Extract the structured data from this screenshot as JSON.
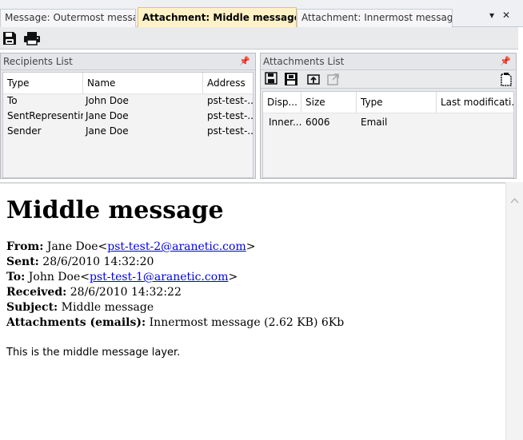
{
  "tabs": [
    {
      "label": "Message: Outermost message"
    },
    {
      "label": "Attachment:  Middle  message..."
    },
    {
      "label": "Attachment:  Innermost  message..."
    }
  ],
  "toolbar": {
    "icons": [
      "save-icon",
      "print-icon"
    ]
  },
  "recipients": {
    "title": "Recipients List",
    "columns": [
      "Type",
      "Name",
      "Address"
    ],
    "rows": [
      [
        "To",
        "John Doe",
        "pst-test-..."
      ],
      [
        "SentRepresenting",
        "Jane Doe",
        "pst-test-..."
      ],
      [
        "Sender",
        "Jane Doe",
        "pst-test-..."
      ]
    ]
  },
  "attachments": {
    "title": "Attachments List",
    "columns": [
      "Disp...",
      "Size",
      "Type",
      "Last modificati..."
    ],
    "rows": [
      [
        "Inner...",
        "6006",
        "Email",
        ""
      ]
    ]
  },
  "message": {
    "heading": "Middle message",
    "from_label": "From:",
    "from_name": "Jane Doe",
    "from_email": "pst-test-2@aranetic.com",
    "sent_label": "Sent:",
    "sent_value": "28/6/2010 14:32:20",
    "to_label": "To:",
    "to_name": "John Doe",
    "to_email": "pst-test-1@aranetic.com",
    "received_label": "Received:",
    "received_value": "28/6/2010 14:32:22",
    "subject_label": "Subject:",
    "subject_value": "Middle message",
    "attachments_label": "Attachments (emails):",
    "attachments_value": "Innermost message (2.62 KB) 6Kb",
    "body": "This is the middle message layer."
  },
  "colors": {
    "active_tab": "#fff2c6",
    "link": "#0000ee"
  }
}
